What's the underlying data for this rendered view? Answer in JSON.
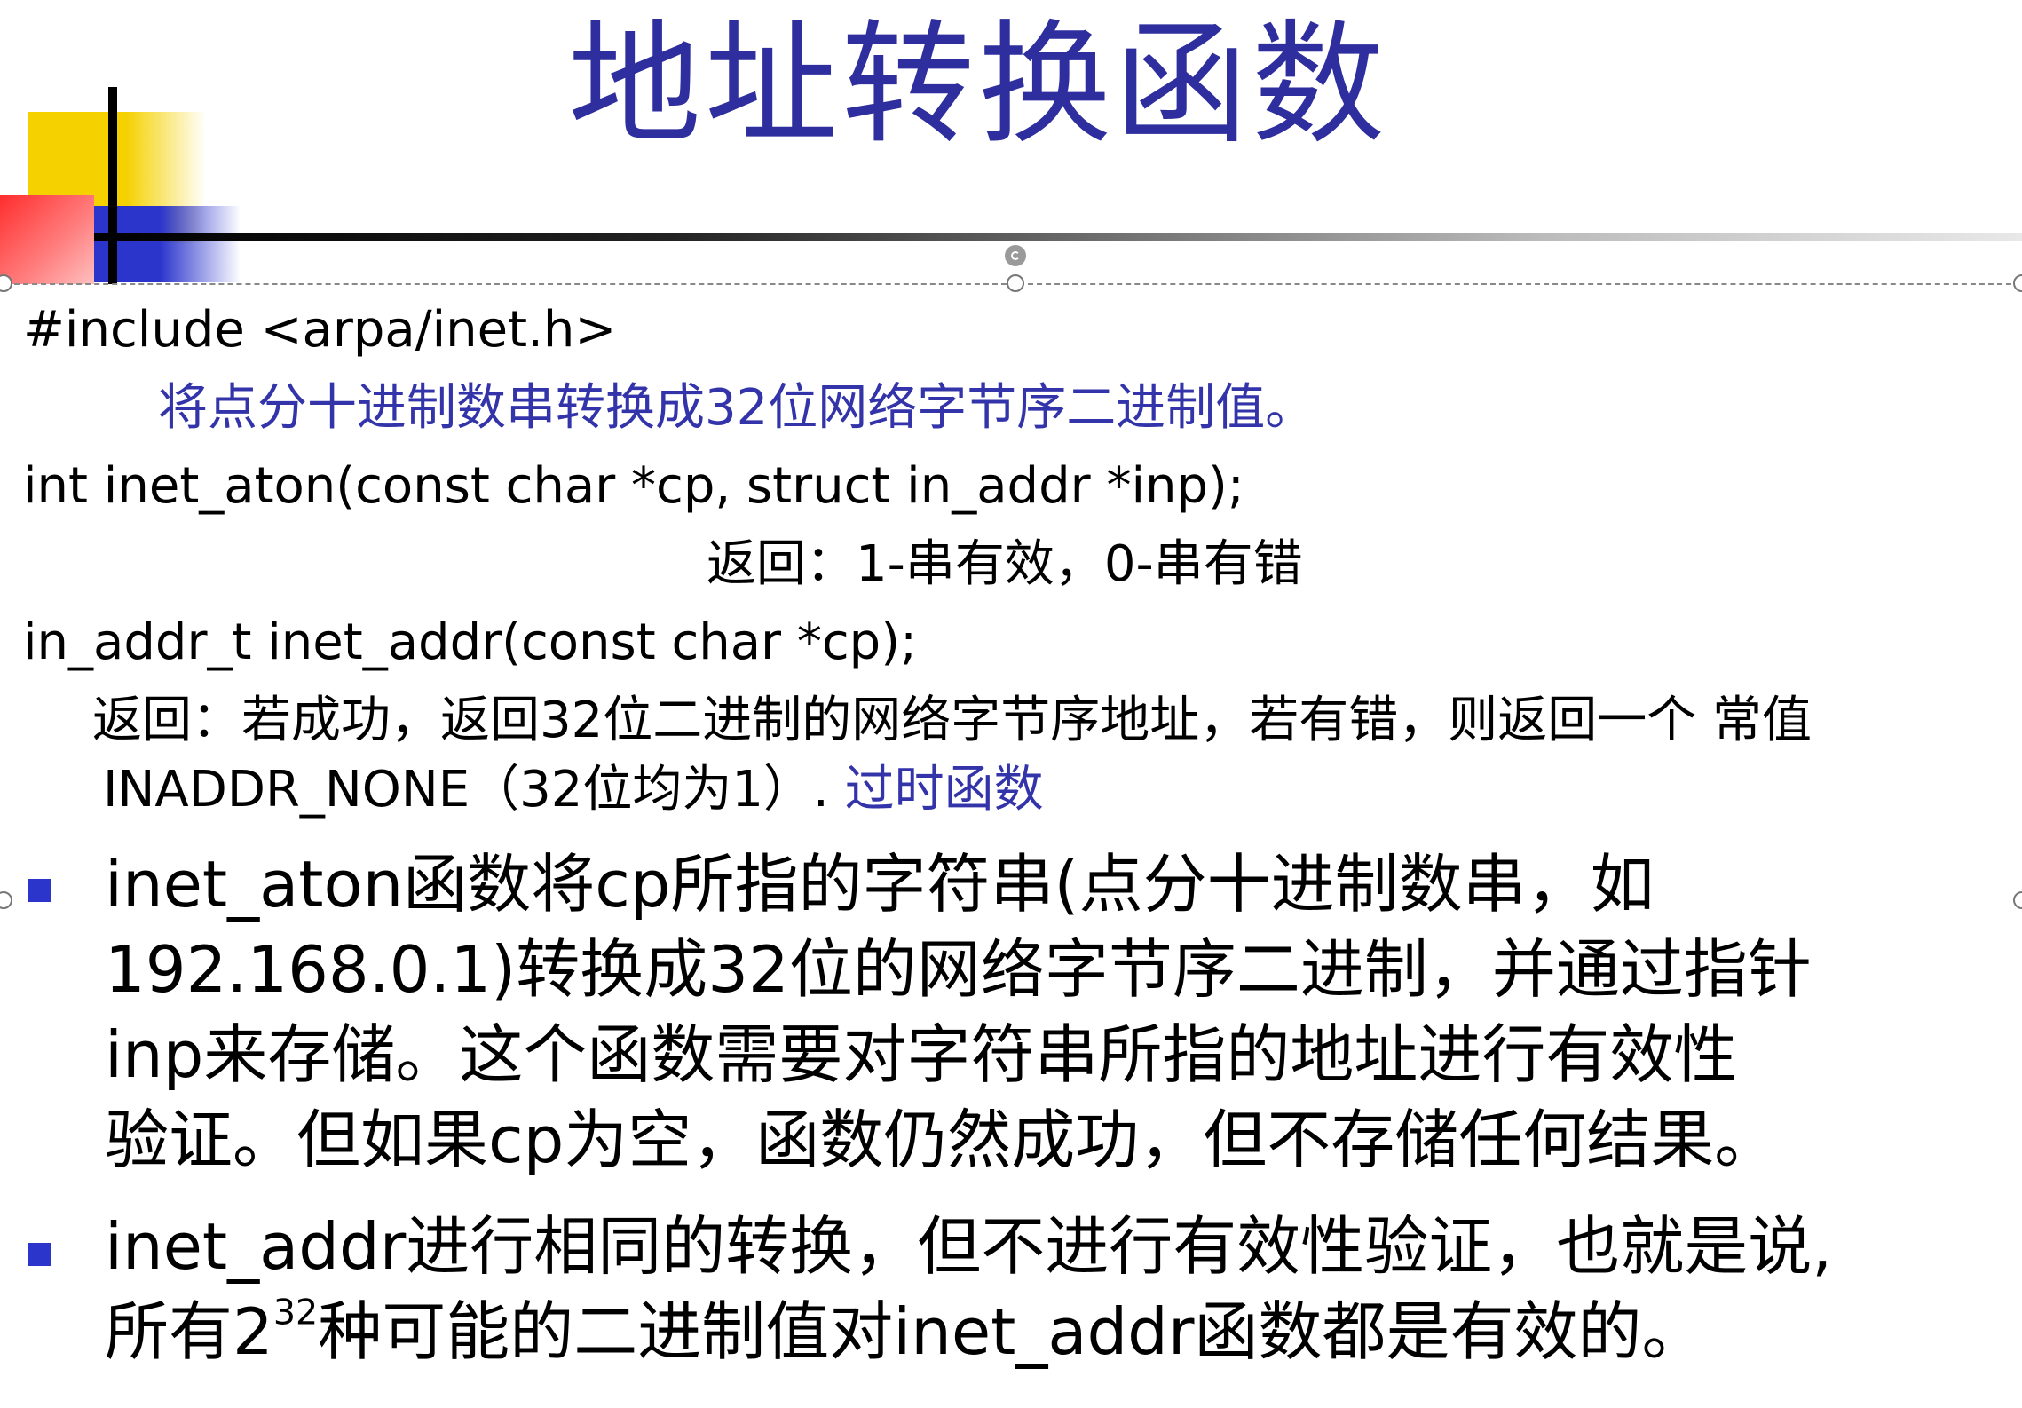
{
  "slide": {
    "title": "地址转换函数",
    "lines": {
      "include": "#include <arpa/inet.h>",
      "aton_desc": "将点分十进制数串转换成32位网络字节序二进制值。",
      "aton_sig": "int inet_aton(const char *cp, struct in_addr *inp);",
      "aton_ret": "返回：1-串有效，0-串有错",
      "addr_sig": "in_addr_t inet_addr(const char *cp);",
      "addr_ret": "返回：若成功，返回32位二进制的网络字节序地址，若有错，则返回一个 常值",
      "addr_ret2": "INADDR_NONE（32位均为1）.",
      "obsolete": "过时函数"
    },
    "bullets": {
      "b1_l1": "inet_aton函数将cp所指的字符串(点分十进制数串，如",
      "b1_l2": "192.168.0.1)转换成32位的网络字节序二进制，并通过指针",
      "b1_l3": "inp来存储。这个函数需要对字符串所指的地址进行有效性",
      "b1_l4": "验证。但如果cp为空，函数仍然成功，但不存储任何结果。",
      "b2_l1": "inet_addr进行相同的转换，但不进行有效性验证，也就是说,",
      "b2_l2_pre": "所有2",
      "b2_l2_sup": "32",
      "b2_l2_post": "种可能的二进制值对inet_addr函数都是有效的。"
    }
  },
  "colors": {
    "title": "#2e2e9e",
    "accent_text": "#3333aa",
    "bullet": "#2b35cc",
    "deco_yellow": "#f5d100",
    "deco_red": "#ff2d2d",
    "deco_blue": "#2b35cc"
  }
}
